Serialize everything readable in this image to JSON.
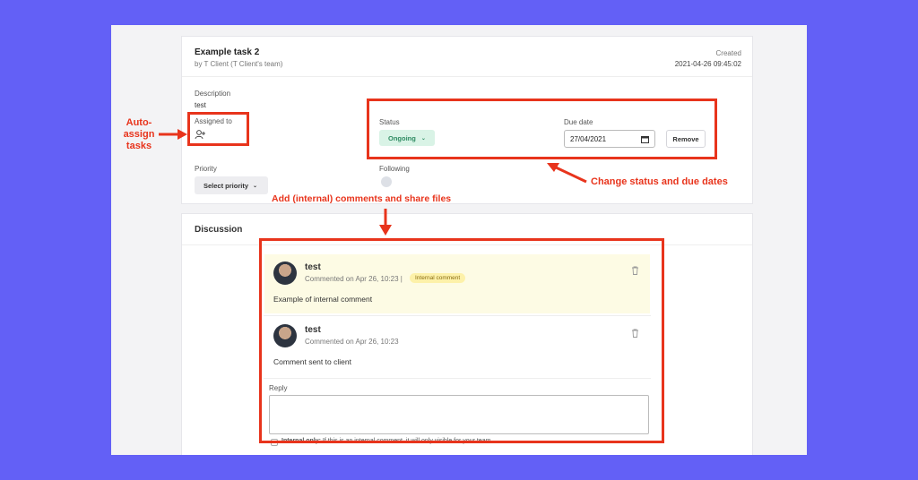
{
  "task": {
    "title": "Example task 2",
    "byline": "by T Client (T Client's team)",
    "created_label": "Created",
    "created_value": "2021-04-26 09:45:02",
    "description_label": "Description",
    "description_value": "test",
    "assigned_label": "Assigned to",
    "status_label": "Status",
    "status_value": "Ongoing",
    "due_label": "Due date",
    "due_value": "27/04/2021",
    "remove_label": "Remove",
    "priority_label": "Priority",
    "priority_value": "Select priority",
    "following_label": "Following"
  },
  "discussion": {
    "heading": "Discussion",
    "comments": [
      {
        "author": "test",
        "meta": "Commented on Apr 26, 10:23 |",
        "badge": "Internal comment",
        "body": "Example of internal comment"
      },
      {
        "author": "test",
        "meta": "Commented on Apr 26, 10:23",
        "badge": "",
        "body": "Comment sent to client"
      }
    ],
    "reply_label": "Reply",
    "internal_label": "Internal only:",
    "internal_hint": "If this is an internal comment, it will only visible for your team."
  },
  "annotations": {
    "auto_assign": [
      "Auto-",
      "assign",
      "tasks"
    ],
    "status_due": "Change status and due dates",
    "comments": "Add (internal) comments and share files"
  },
  "colors": {
    "background": "#6360f6",
    "annotation": "#e8341c",
    "status_bg": "#d9f3e6",
    "internal_bg": "#fdfbe4"
  }
}
